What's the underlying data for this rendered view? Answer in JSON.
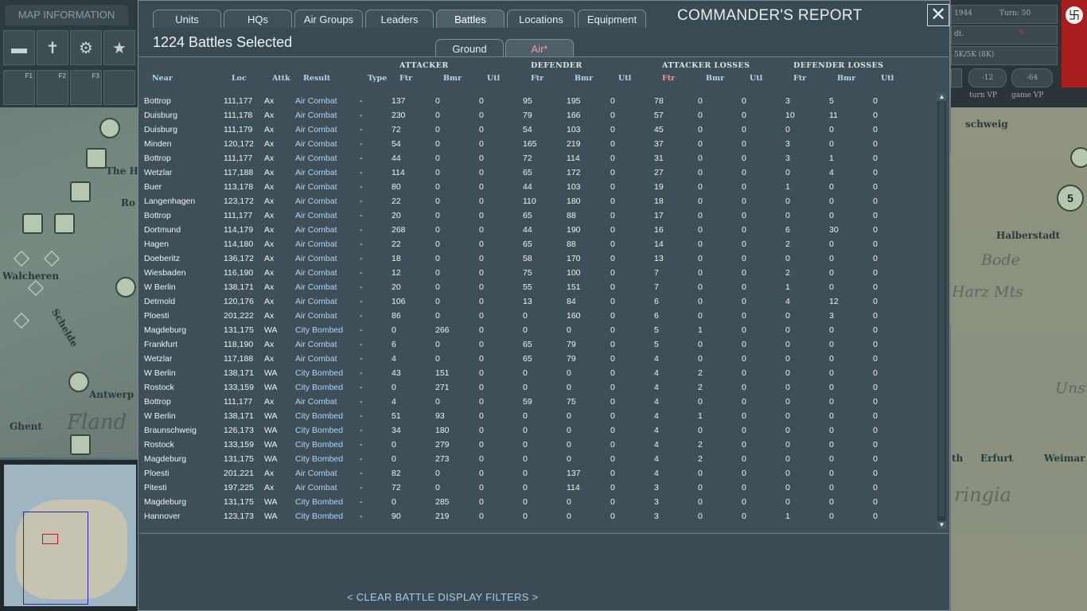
{
  "left_hud": {
    "map_info_label": "MAP INFORMATION",
    "key_hints": [
      "F1",
      "F2",
      "F3"
    ]
  },
  "map": {
    "labels": [
      "The H",
      "Walcheren",
      "Schelde",
      "Antwerp",
      "Ghent",
      "Fland",
      "Halberstadt",
      "Bode",
      "Harz Mts",
      "Erfurt",
      "Weimar",
      "Unstr",
      "ringia",
      "schweig",
      "Ro",
      "th"
    ],
    "unit_badge": "5"
  },
  "right_hud": {
    "date": "1944",
    "turn_label": "Turn: 50",
    "row2_label": "dt.",
    "row3_text": "5K/5K (8K)",
    "turn_vp_value": "-12",
    "game_vp_value": "-64",
    "turn_vp_label": "turn VP",
    "game_vp_label": "game VP"
  },
  "dialog": {
    "title": "COMMANDER'S REPORT",
    "close_symbol": "✕",
    "tabs": [
      "Units",
      "HQs",
      "Air Groups",
      "Leaders",
      "Battles",
      "Locations",
      "Equipment"
    ],
    "active_tab": "Battles",
    "battles_selected": "1224 Battles Selected",
    "sub_tabs": [
      "Ground",
      "Air*"
    ],
    "active_sub_tab": "Air*",
    "group_headers": [
      "ATTACKER",
      "DEFENDER",
      "ATTACKER LOSSES",
      "DEFENDER LOSSES"
    ],
    "columns": [
      "Near",
      "Loc",
      "Attk",
      "Result",
      "Type",
      "Ftr",
      "Bmr",
      "Utl",
      "Ftr",
      "Bmr",
      "Utl",
      "Ftr",
      "Bmr",
      "Utl",
      "Ftr",
      "Bmr",
      "Utl"
    ],
    "sorted_column_index": 11,
    "rows": [
      [
        "Bottrop",
        "111,177",
        "Ax",
        "Air Combat",
        "-",
        "137",
        "0",
        "0",
        "95",
        "195",
        "0",
        "78",
        "0",
        "0",
        "3",
        "5",
        "0"
      ],
      [
        "Duisburg",
        "111,178",
        "Ax",
        "Air Combat",
        "-",
        "230",
        "0",
        "0",
        "79",
        "166",
        "0",
        "57",
        "0",
        "0",
        "10",
        "11",
        "0"
      ],
      [
        "Duisburg",
        "111,179",
        "Ax",
        "Air Combat",
        "-",
        "72",
        "0",
        "0",
        "54",
        "103",
        "0",
        "45",
        "0",
        "0",
        "0",
        "0",
        "0"
      ],
      [
        "Minden",
        "120,172",
        "Ax",
        "Air Combat",
        "-",
        "54",
        "0",
        "0",
        "165",
        "219",
        "0",
        "37",
        "0",
        "0",
        "3",
        "0",
        "0"
      ],
      [
        "Bottrop",
        "111,177",
        "Ax",
        "Air Combat",
        "-",
        "44",
        "0",
        "0",
        "72",
        "114",
        "0",
        "31",
        "0",
        "0",
        "3",
        "1",
        "0"
      ],
      [
        "Wetzlar",
        "117,188",
        "Ax",
        "Air Combat",
        "-",
        "114",
        "0",
        "0",
        "65",
        "172",
        "0",
        "27",
        "0",
        "0",
        "0",
        "4",
        "0"
      ],
      [
        "Buer",
        "113,178",
        "Ax",
        "Air Combat",
        "-",
        "80",
        "0",
        "0",
        "44",
        "103",
        "0",
        "19",
        "0",
        "0",
        "1",
        "0",
        "0"
      ],
      [
        "Langenhagen",
        "123,172",
        "Ax",
        "Air Combat",
        "-",
        "22",
        "0",
        "0",
        "110",
        "180",
        "0",
        "18",
        "0",
        "0",
        "0",
        "0",
        "0"
      ],
      [
        "Bottrop",
        "111,177",
        "Ax",
        "Air Combat",
        "-",
        "20",
        "0",
        "0",
        "65",
        "88",
        "0",
        "17",
        "0",
        "0",
        "0",
        "0",
        "0"
      ],
      [
        "Dortmund",
        "114,179",
        "Ax",
        "Air Combat",
        "-",
        "268",
        "0",
        "0",
        "44",
        "190",
        "0",
        "16",
        "0",
        "0",
        "6",
        "30",
        "0"
      ],
      [
        "Hagen",
        "114,180",
        "Ax",
        "Air Combat",
        "-",
        "22",
        "0",
        "0",
        "65",
        "88",
        "0",
        "14",
        "0",
        "0",
        "2",
        "0",
        "0"
      ],
      [
        "Doeberitz",
        "136,172",
        "Ax",
        "Air Combat",
        "-",
        "18",
        "0",
        "0",
        "58",
        "170",
        "0",
        "13",
        "0",
        "0",
        "0",
        "0",
        "0"
      ],
      [
        "Wiesbaden",
        "116,190",
        "Ax",
        "Air Combat",
        "-",
        "12",
        "0",
        "0",
        "75",
        "100",
        "0",
        "7",
        "0",
        "0",
        "2",
        "0",
        "0"
      ],
      [
        "W Berlin",
        "138,171",
        "Ax",
        "Air Combat",
        "-",
        "20",
        "0",
        "0",
        "55",
        "151",
        "0",
        "7",
        "0",
        "0",
        "1",
        "0",
        "0"
      ],
      [
        "Detmold",
        "120,176",
        "Ax",
        "Air Combat",
        "-",
        "106",
        "0",
        "0",
        "13",
        "84",
        "0",
        "6",
        "0",
        "0",
        "4",
        "12",
        "0"
      ],
      [
        "Ploesti",
        "201,222",
        "Ax",
        "Air Combat",
        "-",
        "86",
        "0",
        "0",
        "0",
        "160",
        "0",
        "6",
        "0",
        "0",
        "0",
        "3",
        "0"
      ],
      [
        "Magdeburg",
        "131,175",
        "WA",
        "City Bombed",
        "-",
        "0",
        "266",
        "0",
        "0",
        "0",
        "0",
        "5",
        "1",
        "0",
        "0",
        "0",
        "0"
      ],
      [
        "Frankfurt",
        "118,190",
        "Ax",
        "Air Combat",
        "-",
        "6",
        "0",
        "0",
        "65",
        "79",
        "0",
        "5",
        "0",
        "0",
        "0",
        "0",
        "0"
      ],
      [
        "Wetzlar",
        "117,188",
        "Ax",
        "Air Combat",
        "-",
        "4",
        "0",
        "0",
        "65",
        "79",
        "0",
        "4",
        "0",
        "0",
        "0",
        "0",
        "0"
      ],
      [
        "W Berlin",
        "138,171",
        "WA",
        "City Bombed",
        "-",
        "43",
        "151",
        "0",
        "0",
        "0",
        "0",
        "4",
        "2",
        "0",
        "0",
        "0",
        "0"
      ],
      [
        "Rostock",
        "133,159",
        "WA",
        "City Bombed",
        "-",
        "0",
        "271",
        "0",
        "0",
        "0",
        "0",
        "4",
        "2",
        "0",
        "0",
        "0",
        "0"
      ],
      [
        "Bottrop",
        "111,177",
        "Ax",
        "Air Combat",
        "-",
        "4",
        "0",
        "0",
        "59",
        "75",
        "0",
        "4",
        "0",
        "0",
        "0",
        "0",
        "0"
      ],
      [
        "W Berlin",
        "138,171",
        "WA",
        "City Bombed",
        "-",
        "51",
        "93",
        "0",
        "0",
        "0",
        "0",
        "4",
        "1",
        "0",
        "0",
        "0",
        "0"
      ],
      [
        "Braunschweig",
        "126,173",
        "WA",
        "City Bombed",
        "-",
        "34",
        "180",
        "0",
        "0",
        "0",
        "0",
        "4",
        "0",
        "0",
        "0",
        "0",
        "0"
      ],
      [
        "Rostock",
        "133,159",
        "WA",
        "City Bombed",
        "-",
        "0",
        "279",
        "0",
        "0",
        "0",
        "0",
        "4",
        "2",
        "0",
        "0",
        "0",
        "0"
      ],
      [
        "Magdeburg",
        "131,175",
        "WA",
        "City Bombed",
        "-",
        "0",
        "273",
        "0",
        "0",
        "0",
        "0",
        "4",
        "2",
        "0",
        "0",
        "0",
        "0"
      ],
      [
        "Ploesti",
        "201,221",
        "Ax",
        "Air Combat",
        "-",
        "82",
        "0",
        "0",
        "0",
        "137",
        "0",
        "4",
        "0",
        "0",
        "0",
        "0",
        "0"
      ],
      [
        "Pitesti",
        "197,225",
        "Ax",
        "Air Combat",
        "-",
        "72",
        "0",
        "0",
        "0",
        "114",
        "0",
        "3",
        "0",
        "0",
        "0",
        "0",
        "0"
      ],
      [
        "Magdeburg",
        "131,175",
        "WA",
        "City Bombed",
        "-",
        "0",
        "285",
        "0",
        "0",
        "0",
        "0",
        "3",
        "0",
        "0",
        "0",
        "0",
        "0"
      ],
      [
        "Hannover",
        "123,173",
        "WA",
        "City Bombed",
        "-",
        "90",
        "219",
        "0",
        "0",
        "0",
        "0",
        "3",
        "0",
        "0",
        "1",
        "0",
        "0"
      ]
    ],
    "clear_filters_label": "< CLEAR BATTLE DISPLAY FILTERS >"
  },
  "colors": {
    "dialog_bg": "#3a4a52",
    "column_header": "#b5d5ea",
    "sorted_header": "#f09a96",
    "result_text": "#a8d6ff",
    "active_subtab": "#f2a09d"
  }
}
